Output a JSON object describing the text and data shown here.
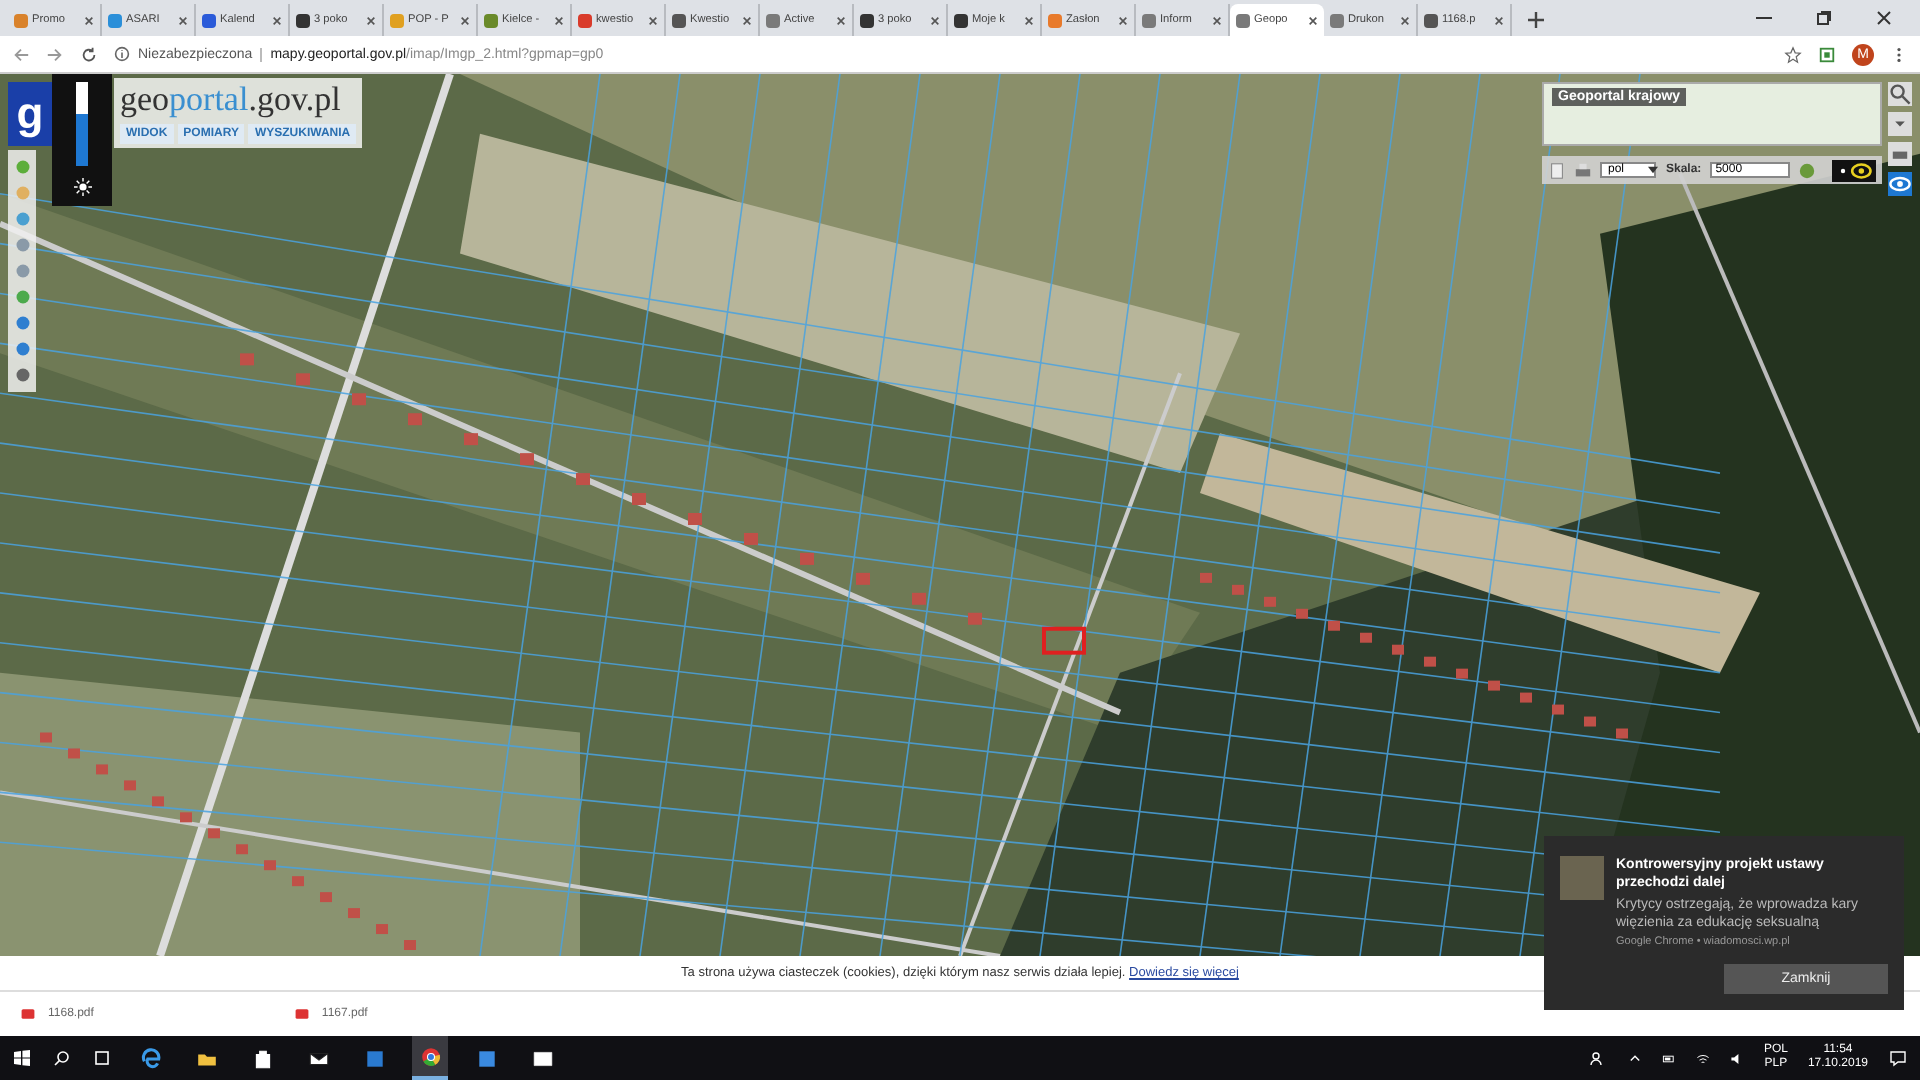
{
  "tabs": [
    {
      "label": "Promo",
      "selected": false,
      "color": "#d9822b"
    },
    {
      "label": "ASARI",
      "selected": false,
      "color": "#2b8fd9"
    },
    {
      "label": "Kalend",
      "selected": false,
      "color": "#2b5bd9"
    },
    {
      "label": "3 poko",
      "selected": false,
      "color": "#333333"
    },
    {
      "label": "POP - P",
      "selected": false,
      "color": "#e0a020"
    },
    {
      "label": "Kielce -",
      "selected": false,
      "color": "#6a8a2a"
    },
    {
      "label": "kwestio",
      "selected": false,
      "color": "#d93b2b"
    },
    {
      "label": "Kwestio",
      "selected": false,
      "color": "#555555"
    },
    {
      "label": "Active",
      "selected": false,
      "color": "#7a7a7a"
    },
    {
      "label": "3 poko",
      "selected": false,
      "color": "#333333"
    },
    {
      "label": "Moje k",
      "selected": false,
      "color": "#333333"
    },
    {
      "label": "Zasłon",
      "selected": false,
      "color": "#e87a2b"
    },
    {
      "label": "Inform",
      "selected": false,
      "color": "#7a7a7a"
    },
    {
      "label": "Geopo",
      "selected": true,
      "color": "#7a7a7a"
    },
    {
      "label": "Drukon",
      "selected": false,
      "color": "#7a7a7a"
    },
    {
      "label": "1168.p",
      "selected": false,
      "color": "#555555"
    }
  ],
  "address": {
    "security": "Niezabezpieczona",
    "host": "mapy.geoportal.gov.pl",
    "path": "/imap/Imgp_2.html?gpmap=gp0",
    "profile": "M"
  },
  "geoportal": {
    "logo_mark": "g",
    "logo": "geo**portal**.gov.pl",
    "menu": [
      "WIDOK",
      "POMIARY",
      "WYSZUKIWANIA"
    ],
    "opacity": {
      "level": 0.62
    },
    "overview": {
      "title": "Geoportal krajowy",
      "language": "pol",
      "scale_label": "Skala:",
      "scale": "5000"
    }
  },
  "notification": {
    "title": "Kontrowersyjny projekt ustawy przechodzi dalej",
    "body": "Krytycy ostrzegają, że wprowadza kary więzienia za edukację seksualną",
    "source": "Google Chrome • wiadomosci.wp.pl",
    "button": "Zamknij"
  },
  "cookie_bar": {
    "text": "Ta strona używa ciasteczek (cookies), dzięki którym nasz serwis działa lepiej.",
    "link": "Dowiedz się więcej"
  },
  "downloads": [
    "1168.pdf",
    "1167.pdf"
  ],
  "taskbar": {
    "apps": [
      {
        "kind": "edge",
        "selected": false
      },
      {
        "kind": "folder",
        "selected": false
      },
      {
        "kind": "store",
        "selected": false
      },
      {
        "kind": "mail",
        "selected": false
      },
      {
        "kind": "app",
        "selected": false
      },
      {
        "kind": "chrome",
        "selected": true
      },
      {
        "kind": "paint",
        "selected": false
      },
      {
        "kind": "photos",
        "selected": false
      }
    ],
    "language": "POL",
    "layout": "PLP",
    "time": "11:54",
    "date": "17.10.2019"
  }
}
